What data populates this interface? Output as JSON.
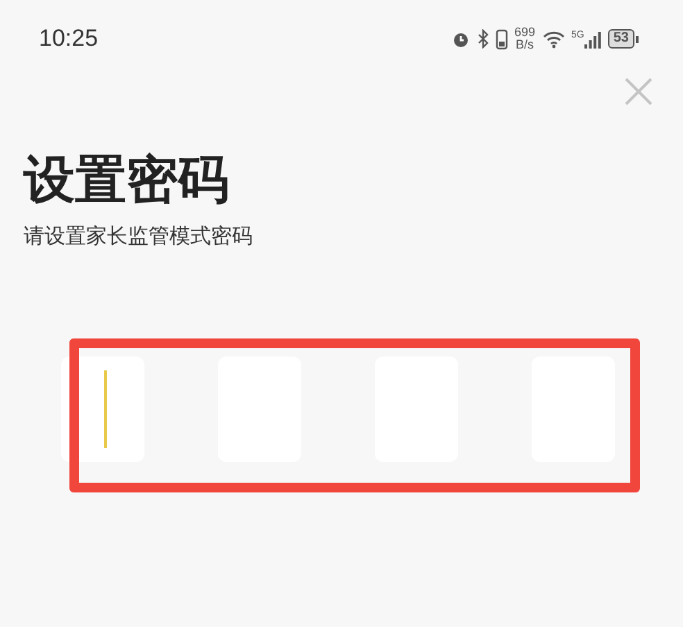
{
  "status_bar": {
    "time": "10:25",
    "net_speed_value": "699",
    "net_speed_unit": "B/s",
    "network": "5G",
    "battery": "53"
  },
  "title": "设置密码",
  "subtitle": "请设置家长监管模式密码",
  "pin_boxes": [
    {
      "focused": true
    },
    {
      "focused": false
    },
    {
      "focused": false
    },
    {
      "focused": false
    }
  ],
  "highlight": {
    "color": "#f0463c"
  }
}
